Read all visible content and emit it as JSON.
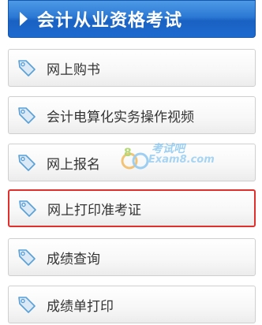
{
  "header": {
    "title": "会计从业资格考试"
  },
  "menu": {
    "items": [
      {
        "label": "网上购书",
        "highlighted": false
      },
      {
        "label": "会计电算化实务操作视频",
        "highlighted": false
      },
      {
        "label": "网上报名",
        "highlighted": false
      },
      {
        "label": "网上打印准考证",
        "highlighted": true
      },
      {
        "label": "成绩查询",
        "highlighted": false
      },
      {
        "label": "成绩单打印",
        "highlighted": false
      }
    ],
    "icon": "tag-icon"
  },
  "watermark": {
    "brand_cn": "考试吧",
    "brand_en": "Exam8.com"
  },
  "colors": {
    "header_blue": "#1d6ad0",
    "highlight_border": "#e0302e",
    "icon_blue": "#5aa0d8"
  }
}
